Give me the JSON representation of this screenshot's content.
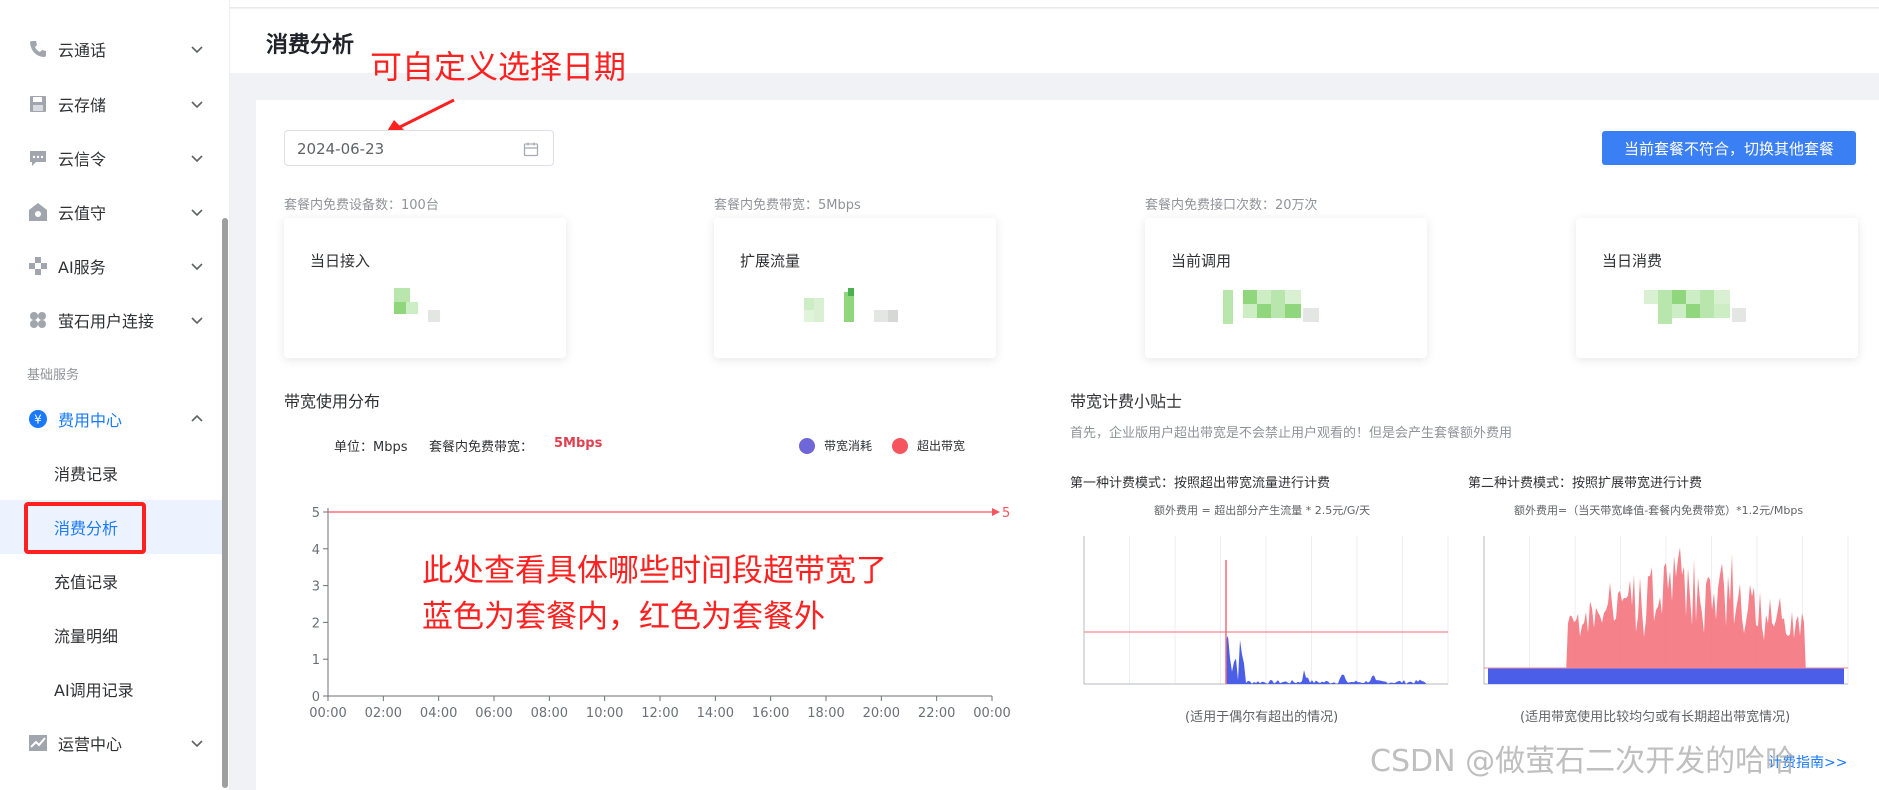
{
  "sidebar": {
    "items": [
      {
        "label": "云通话",
        "icon": "phone-icon"
      },
      {
        "label": "云存储",
        "icon": "floppy-disk-icon"
      },
      {
        "label": "云信令",
        "icon": "message-icon"
      },
      {
        "label": "云值守",
        "icon": "home-shield-icon"
      },
      {
        "label": "AI服务",
        "icon": "puzzle-icon"
      },
      {
        "label": "萤石用户连接",
        "icon": "clover-icon"
      }
    ],
    "group_title": "基础服务",
    "billing": {
      "label": "费用中心",
      "icon": "yen-circle-icon"
    },
    "sub_items": [
      "消费记录",
      "消费分析",
      "充值记录",
      "流量明细",
      "AI调用记录"
    ],
    "ops": {
      "label": "运营中心",
      "icon": "trend-chart-icon"
    }
  },
  "page": {
    "title": "消费分析"
  },
  "annotations": {
    "date_hint": "可自定义选择日期",
    "chart_hint_line1": "此处查看具体哪些时间段超带宽了",
    "chart_hint_line2": "蓝色为套餐内，红色为套餐外"
  },
  "date_picker": {
    "value": "2024-06-23"
  },
  "switch_button": "当前套餐不符合，切换其他套餐",
  "quotas": [
    "套餐内免费设备数：100台",
    "套餐内免费带宽：5Mbps",
    "套餐内免费接口次数：20万次"
  ],
  "cards": [
    {
      "title": "当日接入"
    },
    {
      "title": "扩展流量"
    },
    {
      "title": "当前调用"
    },
    {
      "title": "当日消费"
    }
  ],
  "bandwidth": {
    "section_title": "带宽使用分布",
    "unit_label": "单位：Mbps",
    "free_bw_label": "套餐内免费带宽：",
    "free_bw_value": "5Mbps",
    "legend": [
      {
        "name": "带宽消耗",
        "color": "#6f66d8"
      },
      {
        "name": "超出带宽",
        "color": "#f5555e"
      }
    ]
  },
  "chart_data": {
    "type": "line",
    "x": [
      "00:00",
      "02:00",
      "04:00",
      "06:00",
      "08:00",
      "10:00",
      "12:00",
      "14:00",
      "16:00",
      "18:00",
      "20:00",
      "22:00",
      "00:00"
    ],
    "ylim": [
      0,
      5
    ],
    "yticks": [
      "0",
      "1",
      "2",
      "3",
      "4",
      "5"
    ],
    "threshold": 5,
    "threshold_label": "5",
    "series": [
      {
        "name": "带宽消耗",
        "color": "#6f66d8"
      },
      {
        "name": "超出带宽",
        "color": "#f5555e"
      }
    ],
    "grid": false
  },
  "tips": {
    "title": "带宽计费小贴士",
    "desc": "首先，企业版用户超出带宽是不会禁止用户观看的！但是会产生套餐额外费用",
    "mode1": {
      "title": "第一种计费模式：按照超出带宽流量进行计费",
      "formula": "额外费用 = 超出部分产生流量 * 2.5元/G/天",
      "caption": "(适用于偶尔有超出的情况)"
    },
    "mode2": {
      "title": "第二种计费模式：按照扩展带宽进行计费",
      "formula": "额外费用=（当天带宽峰值-套餐内免费带宽）*1.2元/Mbps",
      "caption": "(适用带宽使用比较均匀或有长期超出带宽情况)"
    },
    "guide_link": "计费指南>>"
  },
  "watermark": "CSDN @做萤石二次开发的哈哈"
}
